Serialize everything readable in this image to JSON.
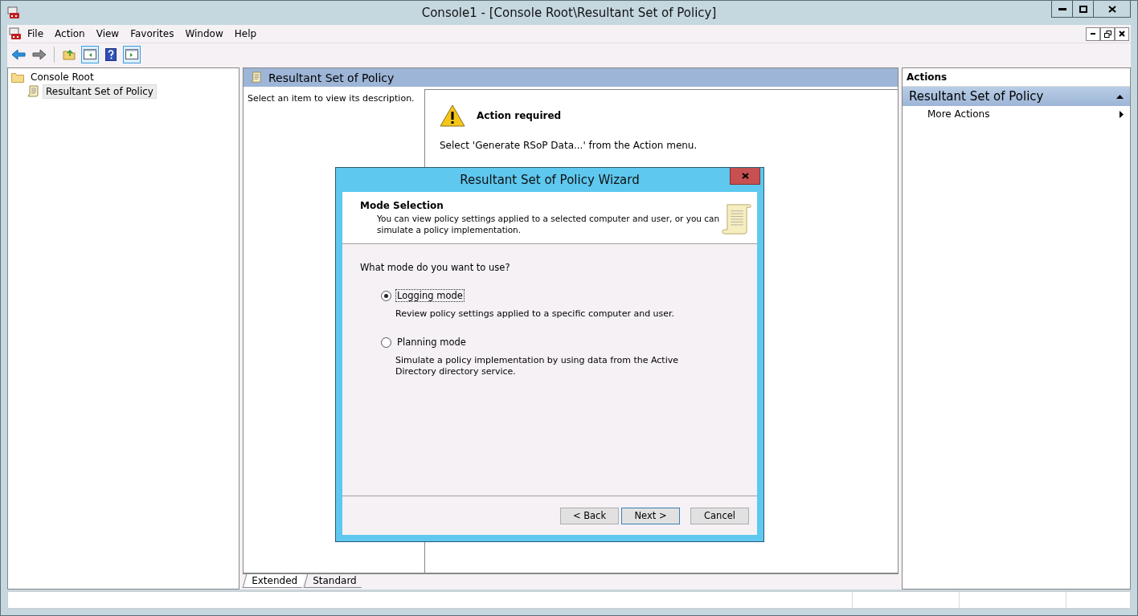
{
  "window": {
    "title": "Console1 - [Console Root\\Resultant Set of Policy]"
  },
  "menu": [
    "File",
    "Action",
    "View",
    "Favorites",
    "Window",
    "Help"
  ],
  "toolbar": [
    {
      "kind": "back",
      "pressed": false
    },
    {
      "kind": "forward",
      "pressed": false
    },
    {
      "kind": "up",
      "pressed": false
    },
    {
      "kind": "tree",
      "pressed": true
    },
    {
      "kind": "help",
      "pressed": false
    },
    {
      "kind": "actionpane",
      "pressed": true
    }
  ],
  "tree": [
    {
      "label": "Console Root",
      "selected": false,
      "children": [
        {
          "label": "Resultant Set of Policy",
          "selected": true
        }
      ]
    }
  ],
  "center": {
    "title": "Resultant Set of Policy",
    "description": "Select an item to view its description.",
    "notice": {
      "title": "Action required",
      "message": "Select 'Generate RSoP Data...' from the Action menu."
    },
    "tabs": [
      {
        "label": "Extended",
        "selected": true
      },
      {
        "label": "Standard",
        "selected": false
      }
    ]
  },
  "actions": {
    "header": "Actions",
    "section": "Resultant Set of Policy",
    "expanded": true,
    "items": [
      "More Actions"
    ]
  },
  "dialog": {
    "title": "Resultant Set of Policy Wizard",
    "heading": "Mode Selection",
    "subtitle": "You can view policy settings applied to a selected computer and user, or you can simulate a policy implementation.",
    "question": "What mode do you want to use?",
    "options": [
      {
        "label": "Logging mode",
        "description": "Review policy settings applied to a specific computer and user.",
        "selected": true
      },
      {
        "label": "Planning mode",
        "description": "Simulate a policy implementation by using data from the Active Directory directory service.",
        "selected": false
      }
    ],
    "buttons": [
      {
        "label": "< Back",
        "kind": "normal"
      },
      {
        "label": "Next >",
        "kind": "default"
      },
      {
        "label": "Cancel",
        "kind": "normal"
      }
    ]
  }
}
